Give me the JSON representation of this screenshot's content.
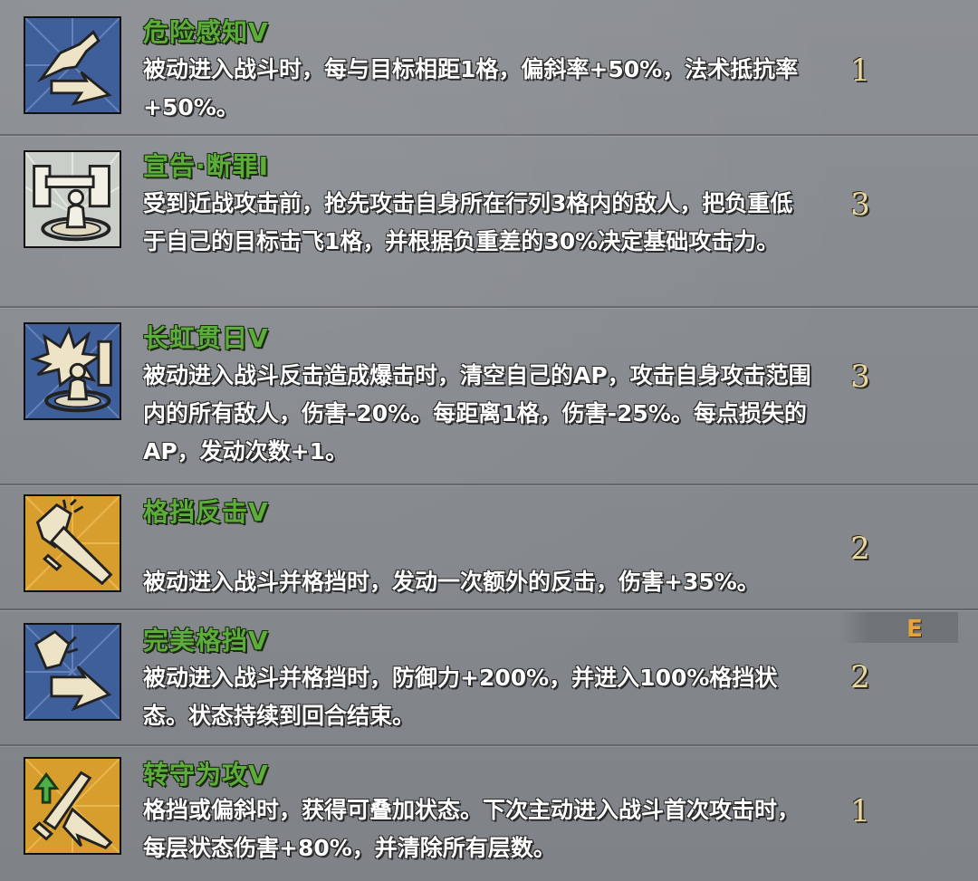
{
  "skills": [
    {
      "name": "危险感知V",
      "description": "被动进入战斗时，每与目标相距1格，偏斜率+50%，法术抵抗率+50%。",
      "cost": "1",
      "icon": "dodge-leap-icon",
      "icon_bg": "#3f5f9a"
    },
    {
      "name": "宣告·断罪I",
      "description": "受到近战攻击前，抢先攻击自身所在行列3格内的敌人，把负重低于自己的目标击飞1格，并根据负重差的30%决定基础攻击力。",
      "cost": "3",
      "icon": "proclamation-pillar-icon",
      "icon_bg": "#c9cfc8"
    },
    {
      "name": "长虹贯日V",
      "description": "被动进入战斗反击造成爆击时，清空自己的AP，攻击自身攻击范围内的所有敌人，伤害-20%。每距离1格，伤害-25%。每点损失的AP，发动次数+1。",
      "cost": "3",
      "icon": "burst-aura-icon",
      "icon_bg": "#3f5f9a"
    },
    {
      "name": "格挡反击V",
      "description": "被动进入战斗并格挡时，发动一次额外的反击，伤害+35%。",
      "cost": "2",
      "icon": "parry-counter-icon",
      "icon_bg": "#d79d2d"
    },
    {
      "name": "完美格挡V",
      "description": "被动进入战斗并格挡时，防御力+200%，并进入100%格挡状态。状态持续到回合结束。",
      "cost": "2",
      "icon": "perfect-block-icon",
      "icon_bg": "#3f5f9a"
    },
    {
      "name": "转守为攻V",
      "description": "格挡或偏斜时，获得可叠加状态。下次主动进入战斗首次攻击时，每层状态伤害+80%，并清除所有层数。",
      "cost": "1",
      "icon": "guard-to-attack-icon",
      "icon_bg": "#d79d2d"
    }
  ],
  "side_tab": {
    "label": "E"
  },
  "colors": {
    "skill_name": "#5cad3a",
    "description": "#ffffff",
    "cost": "#e8d7a1",
    "e_key": "#e8a23a"
  }
}
